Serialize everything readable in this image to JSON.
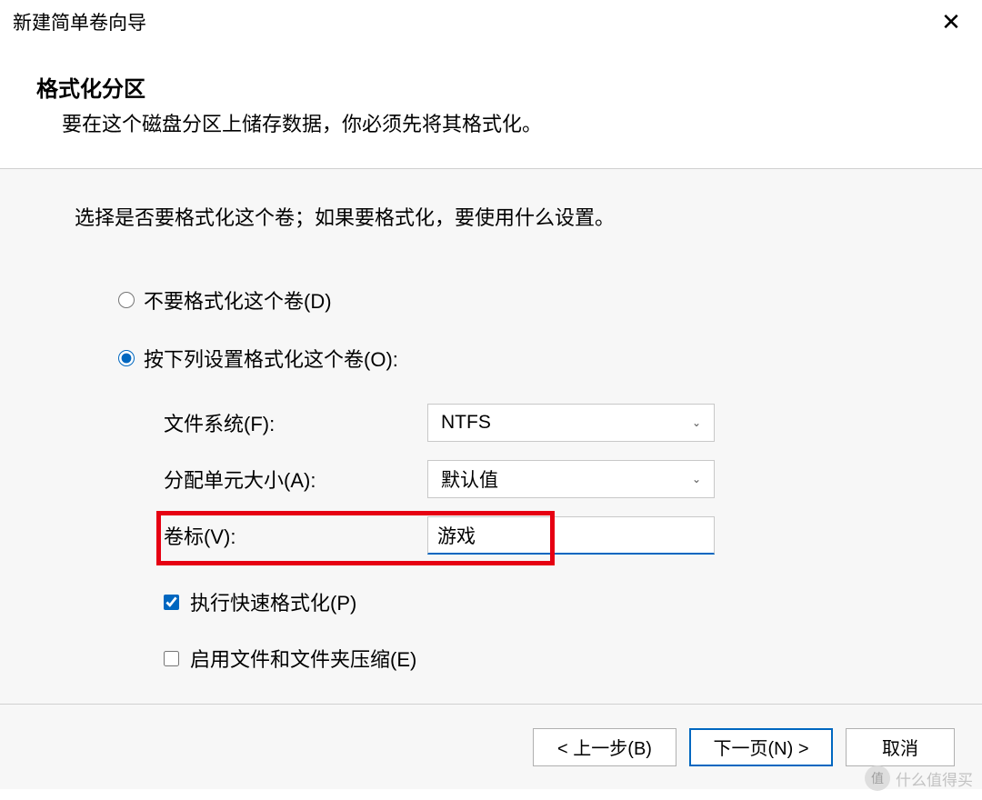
{
  "titlebar": {
    "title": "新建简单卷向导"
  },
  "header": {
    "title": "格式化分区",
    "subtitle": "要在这个磁盘分区上储存数据，你必须先将其格式化。"
  },
  "content": {
    "instruction": "选择是否要格式化这个卷；如果要格式化，要使用什么设置。",
    "radio_no_format": "不要格式化这个卷(D)",
    "radio_format": "按下列设置格式化这个卷(O):",
    "filesystem_label": "文件系统(F):",
    "filesystem_value": "NTFS",
    "allocation_label": "分配单元大小(A):",
    "allocation_value": "默认值",
    "volume_label": "卷标(V):",
    "volume_value": "游戏",
    "quick_format": "执行快速格式化(P)",
    "compression": "启用文件和文件夹压缩(E)"
  },
  "footer": {
    "back": "< 上一步(B)",
    "next": "下一页(N) >",
    "cancel": "取消"
  },
  "watermark": {
    "icon": "值",
    "text": "什么值得买"
  }
}
